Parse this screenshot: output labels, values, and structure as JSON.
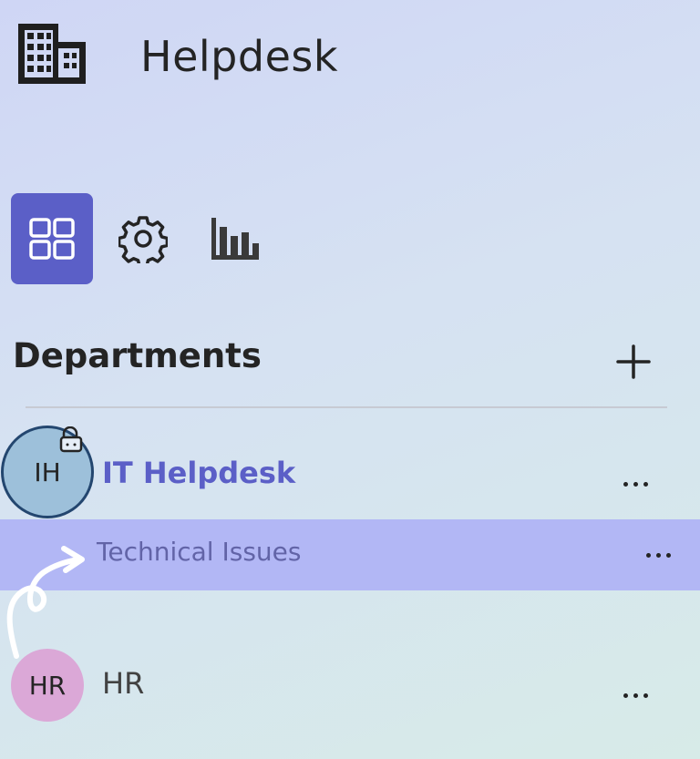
{
  "header": {
    "title": "Helpdesk",
    "icon": "building-icon"
  },
  "tabs": [
    {
      "name": "dashboard",
      "icon": "grid-icon",
      "active": true
    },
    {
      "name": "settings",
      "icon": "gear-icon",
      "active": false
    },
    {
      "name": "analytics",
      "icon": "bar-chart-icon",
      "active": false
    }
  ],
  "departments_section": {
    "title": "Departments",
    "add_icon": "plus-icon"
  },
  "departments": [
    {
      "initials": "IH",
      "name": "IT Helpdesk",
      "avatar_color": "#9dc0da",
      "locked": true,
      "selected": true,
      "channels": [
        {
          "name": "Technical Issues",
          "selected": true
        }
      ]
    },
    {
      "initials": "HR",
      "name": "HR",
      "avatar_color": "#dba8d7",
      "locked": false,
      "selected": false,
      "channels": []
    }
  ],
  "colors": {
    "accent": "#5b5fc7",
    "selected_row": "#b2b7f5",
    "channel_text": "#6264a7"
  }
}
